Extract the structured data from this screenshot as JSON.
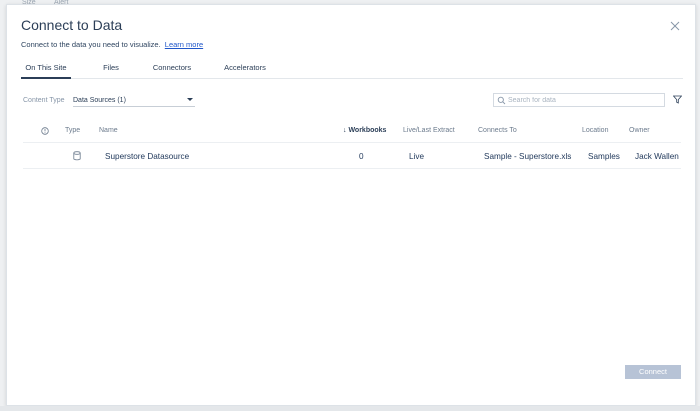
{
  "background": {
    "tabs": [
      "Size",
      "Alert"
    ]
  },
  "dialog": {
    "title": "Connect to Data",
    "subtitle": "Connect to the data you need to visualize.",
    "learn_more": "Learn more",
    "close_icon": "close-icon"
  },
  "tabs": [
    {
      "label": "On This Site",
      "active": true
    },
    {
      "label": "Files",
      "active": false
    },
    {
      "label": "Connectors",
      "active": false
    },
    {
      "label": "Accelerators",
      "active": false
    }
  ],
  "filter": {
    "content_type_label": "Content Type",
    "content_type_value": "Data Sources (1)",
    "search_placeholder": "Search for data"
  },
  "table": {
    "headers": {
      "type": "Type",
      "name": "Name",
      "workbooks": "Workbooks",
      "live": "Live/Last Extract",
      "connects_to": "Connects To",
      "location": "Location",
      "owner": "Owner"
    },
    "sort_indicator": "↓",
    "rows": [
      {
        "name": "Superstore Datasource",
        "workbooks": "0",
        "live": "Live",
        "connects_to": "Sample - Superstore.xls",
        "location": "Samples",
        "owner": "Jack Wallen"
      }
    ]
  },
  "footer": {
    "connect_label": "Connect"
  },
  "colors": {
    "accent": "#1f56c9",
    "text": "#2b3e57",
    "button_disabled": "#b7c3d6"
  }
}
